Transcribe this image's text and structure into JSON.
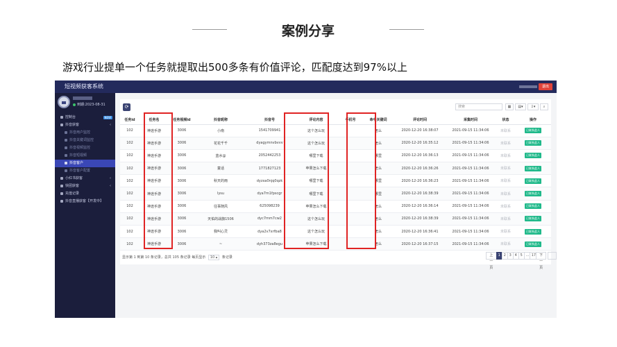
{
  "slide": {
    "title": "案例分享",
    "subtitle": "游戏行业提单一个任务就提取出500多条有价值评论，匹配度达到97%以上"
  },
  "app": {
    "brand": "短视频获客系统",
    "user_expiry": "到期:2023-08-31",
    "exit_label": "退出",
    "nav": [
      {
        "label": "控制台",
        "badge": "NEW",
        "sub": false,
        "active": false
      },
      {
        "label": "抖音获客",
        "sub": false,
        "active": false,
        "chevron": "‹"
      },
      {
        "label": "抖音用户监控",
        "sub": true,
        "active": false
      },
      {
        "label": "抖音关键词监控",
        "sub": true,
        "active": false
      },
      {
        "label": "抖音视频监控",
        "sub": true,
        "active": false
      },
      {
        "label": "抖音短视频",
        "sub": true,
        "active": false
      },
      {
        "label": "抖音客户",
        "sub": true,
        "active": true
      },
      {
        "label": "抖音客户配置",
        "sub": true,
        "active": false
      },
      {
        "label": "小红书获客",
        "sub": false,
        "active": false,
        "chevron": "‹"
      },
      {
        "label": "快团获客",
        "sub": false,
        "active": false,
        "chevron": "‹"
      },
      {
        "label": "充值记录",
        "sub": false,
        "active": false
      },
      {
        "label": "抖音直播获客【开发中】",
        "sub": false,
        "active": false
      }
    ]
  },
  "toolbar": {
    "refresh_icon": "⟳",
    "search_placeholder": "搜索",
    "grid_icon": "▦",
    "list_icon": "▤▾",
    "export_icon": "⇩▾",
    "search_icon": "⌕"
  },
  "table": {
    "columns": [
      "任务id",
      "任务名",
      "任务视频id",
      "抖音昵称",
      "抖音号",
      "评论内容",
      "手机号",
      "命中关键词",
      "评论时间",
      "采集时间",
      "状态",
      "操作"
    ],
    "rows": [
      [
        "102",
        "神途手游",
        "3006",
        "小南",
        "1541709941",
        "这个怎么玩",
        "",
        "怎么",
        "2020-12-20 16:38:07",
        "2021-09-15 11:34:06",
        "未联系",
        "已联系此人"
      ],
      [
        "102",
        "神途手游",
        "3006",
        "花花千千",
        "dyagymnvbvvv",
        "这个怎么玩",
        "",
        "怎么",
        "2020-12-20 16:35:12",
        "2021-09-15 11:34:06",
        "未联系",
        "已联系此人"
      ],
      [
        "102",
        "神途手游",
        "3006",
        "蓝水@",
        "2052442253",
        "哪里下载",
        "",
        "哪里",
        "2020-12-20 16:36:13",
        "2021-09-15 11:34:06",
        "未联系",
        "已联系此人"
      ],
      [
        "102",
        "神途手游",
        "3006",
        "童话",
        "1771827123",
        "苹果怎么下载",
        "",
        "怎么",
        "2020-12-20 16:36:26",
        "2021-09-15 11:34:06",
        "未联系",
        "已联系此人"
      ],
      [
        "102",
        "神途手游",
        "3006",
        "秋天的雨",
        "dyzxa0njq0qzk",
        "哪里下载",
        "",
        "哪里",
        "2020-12-20 16:36:23",
        "2021-09-15 11:34:06",
        "未联系",
        "已联系此人"
      ],
      [
        "102",
        "神途手游",
        "3006",
        "lysu",
        "dya7m1fpscgr",
        "哪里下载",
        "",
        "哪里",
        "2020-12-20 16:38:39",
        "2021-09-15 11:34:06",
        "未联系",
        "已联系此人"
      ],
      [
        "102",
        "神途手游",
        "3006",
        "往事随风",
        "625098239",
        "苹果怎么下载",
        "",
        "怎么",
        "2020-12-20 16:36:14",
        "2021-09-15 11:34:06",
        "未联系",
        "已联系此人"
      ],
      [
        "102",
        "神途手游",
        "3006",
        "天佑的战旗1506",
        "dyc7mm7cw2",
        "这个怎么玩",
        "",
        "怎么",
        "2020-12-20 16:38:39",
        "2021-09-15 11:34:06",
        "未联系",
        "已联系此人"
      ],
      [
        "102",
        "神途手游",
        "3006",
        "我叫心灵",
        "dya2v7xrfba8",
        "这个怎么玩",
        "",
        "怎么",
        "2020-12-20 16:36:41",
        "2021-09-15 11:34:06",
        "未联系",
        "已联系此人"
      ],
      [
        "102",
        "神途手游",
        "3006",
        "~",
        "dyh373za8egu",
        "苹果怎么下载",
        "",
        "怎么",
        "2020-12-20 16:37:15",
        "2021-09-15 11:34:06",
        "未联系",
        "已联系此人"
      ]
    ]
  },
  "footer": {
    "summary": "显示第 1 到第 10 条记录，总共 105 条记录 每页显示",
    "page_size": "10 ▴",
    "summary_suffix": "条记录"
  },
  "pager": {
    "prev": "上一页",
    "pages": [
      "1",
      "2",
      "3",
      "4",
      "5",
      "...",
      "17"
    ],
    "next": "下一页",
    "go": "跳转"
  },
  "colors": {
    "highlight": "#e02323",
    "action": "#1fb98a",
    "sidebar": "#1b1e3c",
    "active_nav": "#3a47b6"
  }
}
